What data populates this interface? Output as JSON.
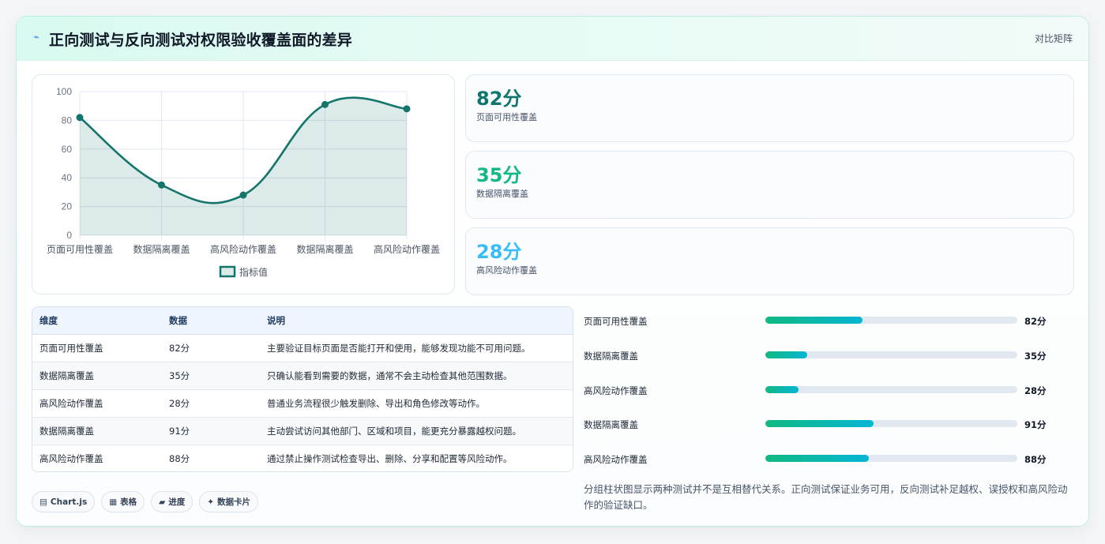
{
  "header": {
    "title": "正向测试与反向测试对权限验收覆盖面的差异",
    "tag": "对比矩阵"
  },
  "colors": {
    "line": "#14756b",
    "fill": "rgba(20,117,107,0.15)",
    "stat_1": "#0f766e",
    "stat_2": "#10b981",
    "stat_3": "#38bdf8",
    "bar_start": "#10b981",
    "bar_end": "#06b6d4"
  },
  "chart_data": {
    "type": "line",
    "categories": [
      "页面可用性覆盖",
      "数据隔离覆盖",
      "高风险动作覆盖",
      "数据隔离覆盖",
      "高风险动作覆盖"
    ],
    "series": [
      {
        "name": "指标值",
        "values": [
          82,
          35,
          28,
          91,
          88
        ]
      }
    ],
    "ylim": [
      0,
      100
    ],
    "yticks": [
      0,
      20,
      40,
      60,
      80,
      100
    ],
    "legend": "bottom",
    "grid": true,
    "title": "",
    "xlabel": "",
    "ylabel": ""
  },
  "stats": [
    {
      "value": "82分",
      "label": "页面可用性覆盖"
    },
    {
      "value": "35分",
      "label": "数据隔离覆盖"
    },
    {
      "value": "28分",
      "label": "高风险动作覆盖"
    }
  ],
  "table": {
    "headers": [
      "维度",
      "数据",
      "说明"
    ],
    "rows": [
      [
        "页面可用性覆盖",
        "82分",
        "主要验证目标页面是否能打开和使用，能够发现功能不可用问题。"
      ],
      [
        "数据隔离覆盖",
        "35分",
        "只确认能看到需要的数据，通常不会主动检查其他范围数据。"
      ],
      [
        "高风险动作覆盖",
        "28分",
        "普通业务流程很少触发删除、导出和角色修改等动作。"
      ],
      [
        "数据隔离覆盖",
        "91分",
        "主动尝试访问其他部门、区域和项目，能更充分暴露越权问题。"
      ],
      [
        "高风险动作覆盖",
        "88分",
        "通过禁止操作测试检查导出、删除、分享和配置等风险动作。"
      ]
    ]
  },
  "badges": [
    {
      "icon": "chart-icon",
      "glyph": "▤",
      "label": "Chart.js"
    },
    {
      "icon": "table-icon",
      "glyph": "▦",
      "label": "表格"
    },
    {
      "icon": "progress-icon",
      "glyph": "▰",
      "label": "进度"
    },
    {
      "icon": "card-icon",
      "glyph": "✦",
      "label": "数据卡片"
    }
  ],
  "bars": [
    {
      "label": "页面可用性覆盖",
      "value": "82分",
      "fraction": 0.385
    },
    {
      "label": "数据隔离覆盖",
      "value": "35分",
      "fraction": 0.165
    },
    {
      "label": "高风险动作覆盖",
      "value": "28分",
      "fraction": 0.132
    },
    {
      "label": "数据隔离覆盖",
      "value": "91分",
      "fraction": 0.428
    },
    {
      "label": "高风险动作覆盖",
      "value": "88分",
      "fraction": 0.412
    }
  ],
  "note": "分组柱状图显示两种测试并不是互相替代关系。正向测试保证业务可用，反向测试补足越权、误授权和高风险动作的验证缺口。"
}
